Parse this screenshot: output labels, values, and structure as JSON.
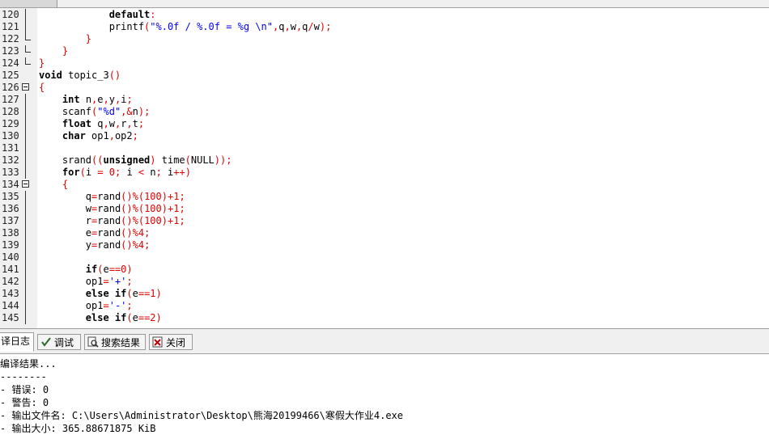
{
  "code": {
    "lines": [
      {
        "n": "120",
        "fold": "line-mid",
        "html": "            <span class=\"kw\">default</span><span class=\"sym\">:</span>"
      },
      {
        "n": "121",
        "fold": "line-mid",
        "html": "            printf<span class=\"sym\">(</span><span class=\"str\">\"%.0f / %.0f = %g \\n\"</span><span class=\"sym\">,</span>q<span class=\"sym\">,</span>w<span class=\"sym\">,</span>q<span class=\"sym\">/</span>w<span class=\"sym\">);</span>"
      },
      {
        "n": "122",
        "fold": "end",
        "html": "        <span class=\"sym\">}</span>"
      },
      {
        "n": "123",
        "fold": "end",
        "html": "    <span class=\"sym\">}</span>"
      },
      {
        "n": "124",
        "fold": "end",
        "html": "<span class=\"sym\">}</span>"
      },
      {
        "n": "125",
        "fold": "",
        "html": "<span class=\"kw\">void</span> topic_3<span class=\"sym\">()</span>"
      },
      {
        "n": "126",
        "fold": "box",
        "html": "<span class=\"sym\">{</span>"
      },
      {
        "n": "127",
        "fold": "line",
        "html": "    <span class=\"kw\">int</span> n<span class=\"sym\">,</span>e<span class=\"sym\">,</span>y<span class=\"sym\">,</span>i<span class=\"sym\">;</span>"
      },
      {
        "n": "128",
        "fold": "line",
        "html": "    scanf<span class=\"sym\">(</span><span class=\"str\">\"%d\"</span><span class=\"sym\">,&amp;</span>n<span class=\"sym\">);</span>"
      },
      {
        "n": "129",
        "fold": "line",
        "html": "    <span class=\"kw\">float</span> q<span class=\"sym\">,</span>w<span class=\"sym\">,</span>r<span class=\"sym\">,</span>t<span class=\"sym\">;</span>"
      },
      {
        "n": "130",
        "fold": "line",
        "html": "    <span class=\"kw\">char</span> op1<span class=\"sym\">,</span>op2<span class=\"sym\">;</span>"
      },
      {
        "n": "131",
        "fold": "line",
        "html": ""
      },
      {
        "n": "132",
        "fold": "line",
        "html": "    srand<span class=\"sym\">((</span><span class=\"kw\">unsigned</span><span class=\"sym\">)</span> time<span class=\"sym\">(</span>NULL<span class=\"sym\">));</span>"
      },
      {
        "n": "133",
        "fold": "line",
        "html": "    <span class=\"kw\">for</span><span class=\"sym\">(</span>i <span class=\"sym\">=</span> <span class=\"num\">0</span><span class=\"sym\">;</span> i <span class=\"sym\">&lt;</span> n<span class=\"sym\">;</span> i<span class=\"sym\">++)</span>"
      },
      {
        "n": "134",
        "fold": "box",
        "html": "    <span class=\"sym\">{</span>"
      },
      {
        "n": "135",
        "fold": "line",
        "html": "        q<span class=\"sym\">=</span>rand<span class=\"sym\">()%(</span><span class=\"num\">100</span><span class=\"sym\">)+</span><span class=\"num\">1</span><span class=\"sym\">;</span>"
      },
      {
        "n": "136",
        "fold": "line",
        "html": "        w<span class=\"sym\">=</span>rand<span class=\"sym\">()%(</span><span class=\"num\">100</span><span class=\"sym\">)+</span><span class=\"num\">1</span><span class=\"sym\">;</span>"
      },
      {
        "n": "137",
        "fold": "line",
        "html": "        r<span class=\"sym\">=</span>rand<span class=\"sym\">()%(</span><span class=\"num\">100</span><span class=\"sym\">)+</span><span class=\"num\">1</span><span class=\"sym\">;</span>"
      },
      {
        "n": "138",
        "fold": "line",
        "html": "        e<span class=\"sym\">=</span>rand<span class=\"sym\">()%</span><span class=\"num\">4</span><span class=\"sym\">;</span>"
      },
      {
        "n": "139",
        "fold": "line",
        "html": "        y<span class=\"sym\">=</span>rand<span class=\"sym\">()%</span><span class=\"num\">4</span><span class=\"sym\">;</span>"
      },
      {
        "n": "140",
        "fold": "line",
        "html": ""
      },
      {
        "n": "141",
        "fold": "line",
        "html": "        <span class=\"kw\">if</span><span class=\"sym\">(</span>e<span class=\"sym\">==</span><span class=\"num\">0</span><span class=\"sym\">)</span>"
      },
      {
        "n": "142",
        "fold": "line",
        "html": "        op1<span class=\"sym\">=</span><span class=\"str\">'+'</span><span class=\"sym\">;</span>"
      },
      {
        "n": "143",
        "fold": "line",
        "html": "        <span class=\"kw\">else if</span><span class=\"sym\">(</span>e<span class=\"sym\">==</span><span class=\"num\">1</span><span class=\"sym\">)</span>"
      },
      {
        "n": "144",
        "fold": "line",
        "html": "        op1<span class=\"sym\">=</span><span class=\"str\">'-'</span><span class=\"sym\">;</span>"
      },
      {
        "n": "145",
        "fold": "line",
        "html": "        <span class=\"kw\">else if</span><span class=\"sym\">(</span>e<span class=\"sym\">==</span><span class=\"num\">2</span><span class=\"sym\">)</span>"
      }
    ]
  },
  "tabs": {
    "compile_log": "译日志",
    "debug": "调试",
    "search_results": "搜索结果",
    "close": "关闭"
  },
  "log": {
    "lines": [
      "编译结果...",
      "--------",
      "- 错误: 0",
      "- 警告: 0",
      "- 输出文件名: C:\\Users\\Administrator\\Desktop\\熊海20199466\\寒假大作业4.exe",
      "- 输出大小: 365.88671875 KiB"
    ]
  },
  "colors": {
    "keyword": "#000000",
    "symbol": "#e00000",
    "string": "#0000ff",
    "gutter": "#f0f0f0"
  }
}
